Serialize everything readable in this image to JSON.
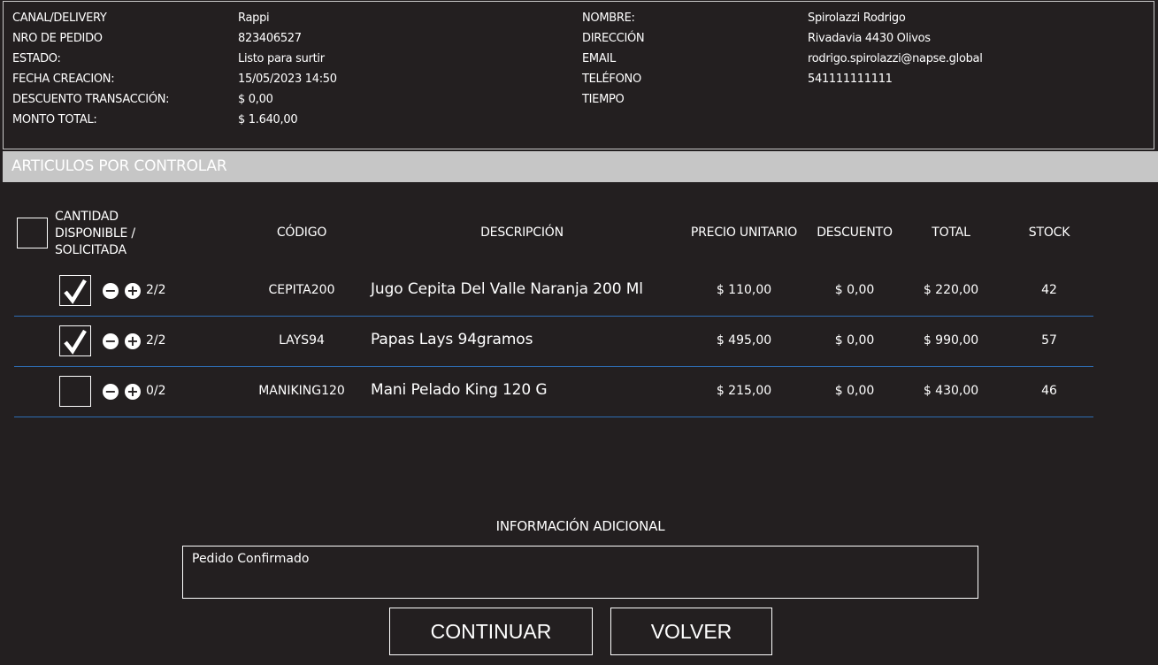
{
  "order": {
    "left": [
      {
        "label": "CANAL/DELIVERY",
        "value": "Rappi"
      },
      {
        "label": "NRO DE PEDIDO",
        "value": "823406527"
      },
      {
        "label": "ESTADO:",
        "value": "Listo para surtir"
      },
      {
        "label": "FECHA CREACION:",
        "value": "15/05/2023 14:50"
      },
      {
        "label": "DESCUENTO TRANSACCIÓN:",
        "value": "$ 0,00"
      },
      {
        "label": "MONTO TOTAL:",
        "value": "$ 1.640,00"
      }
    ],
    "right": [
      {
        "label": "NOMBRE:",
        "value": "Spirolazzi Rodrigo"
      },
      {
        "label": "DIRECCIÓN",
        "value": "Rivadavia 4430 Olivos"
      },
      {
        "label": "EMAIL",
        "value": "rodrigo.spirolazzi@napse.global"
      },
      {
        "label": "TELÉFONO",
        "value": "541111111111"
      },
      {
        "label": "TIEMPO",
        "value": ""
      }
    ]
  },
  "section": {
    "title": "ARTICULOS POR CONTROLAR"
  },
  "table": {
    "headers": {
      "quantity_line1": "CANTIDAD",
      "quantity_line2": "DISPONIBLE /",
      "quantity_line3": "SOLICITADA",
      "code": "CÓDIGO",
      "description": "DESCRIPCIÓN",
      "unit_price": "PRECIO UNITARIO",
      "discount": "DESCUENTO",
      "total": "TOTAL",
      "stock": "STOCK"
    },
    "rows": [
      {
        "checked": true,
        "qty": "2/2",
        "code": "CEPITA200",
        "description": "Jugo Cepita Del Valle Naranja 200 Ml",
        "unit_price": "$ 110,00",
        "discount": "$ 0,00",
        "total": "$ 220,00",
        "stock": "42"
      },
      {
        "checked": true,
        "qty": "2/2",
        "code": "LAYS94",
        "description": "Papas Lays 94gramos",
        "unit_price": "$ 495,00",
        "discount": "$ 0,00",
        "total": "$ 990,00",
        "stock": "57"
      },
      {
        "checked": false,
        "qty": "0/2",
        "code": "MANIKING120",
        "description": "Mani Pelado King 120 G",
        "unit_price": "$ 215,00",
        "discount": "$ 0,00",
        "total": "$ 430,00",
        "stock": "46"
      }
    ],
    "minus_symbol": "−",
    "plus_symbol": "+"
  },
  "additional": {
    "title": "INFORMACIÓN ADICIONAL",
    "value": "Pedido Confirmado"
  },
  "buttons": {
    "continue": "CONTINUAR",
    "back": "VOLVER"
  },
  "colors": {
    "background": "#231f20",
    "section_bar": "#c6c6c6",
    "row_divider": "#2e6db4"
  },
  "icons": {
    "checkmark": "check-icon",
    "minus": "minus-icon",
    "plus": "plus-icon"
  }
}
